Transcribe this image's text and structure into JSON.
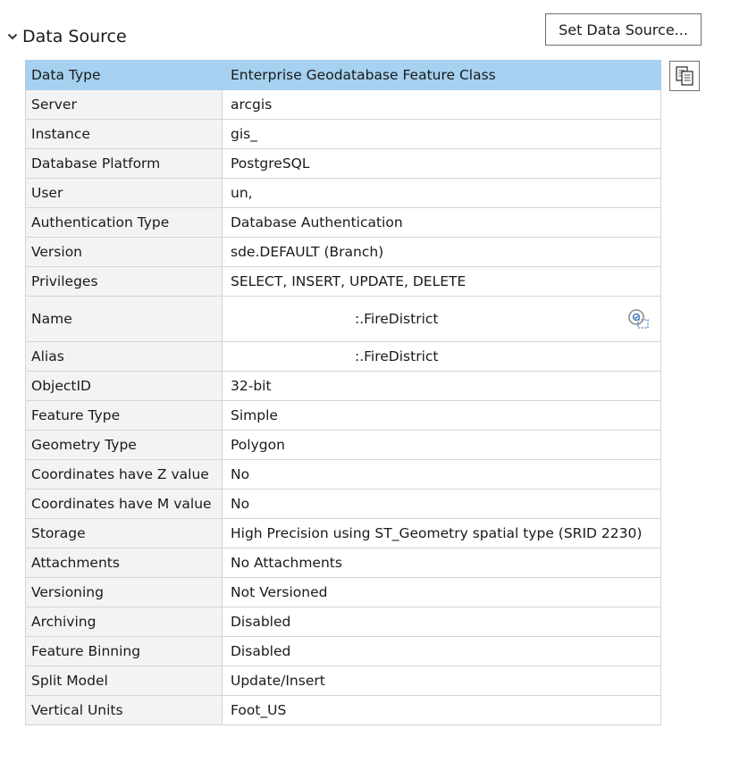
{
  "section": {
    "title": "Data Source",
    "collapse_icon": "chevron-down-icon"
  },
  "toolbar": {
    "set_data_source_label": "Set Data Source...",
    "copy_icon": "copy-icon"
  },
  "properties": [
    {
      "key": "Data Type",
      "value": "Enterprise Geodatabase Feature Class"
    },
    {
      "key": "Server",
      "value": "arcgis"
    },
    {
      "key": "Instance",
      "value": "gis_"
    },
    {
      "key": "Database Platform",
      "value": "PostgreSQL"
    },
    {
      "key": "User",
      "value": "un,"
    },
    {
      "key": "Authentication Type",
      "value": "Database Authentication"
    },
    {
      "key": "Version",
      "value": "sde.DEFAULT (Branch)"
    },
    {
      "key": "Privileges",
      "value": "SELECT, INSERT, UPDATE, DELETE"
    },
    {
      "key": "Name",
      "value": ":.FireDistrict"
    },
    {
      "key": "Alias",
      "value": ":.FireDistrict"
    },
    {
      "key": "ObjectID",
      "value": "32-bit"
    },
    {
      "key": "Feature Type",
      "value": "Simple"
    },
    {
      "key": "Geometry Type",
      "value": "Polygon"
    },
    {
      "key": "Coordinates have Z value",
      "value": "No"
    },
    {
      "key": "Coordinates have M value",
      "value": "No"
    },
    {
      "key": "Storage",
      "value": "High Precision using ST_Geometry spatial type (SRID 2230)"
    },
    {
      "key": "Attachments",
      "value": "No Attachments"
    },
    {
      "key": "Versioning",
      "value": "Not Versioned"
    },
    {
      "key": "Archiving",
      "value": "Disabled"
    },
    {
      "key": "Feature Binning",
      "value": "Disabled"
    },
    {
      "key": "Split Model",
      "value": "Update/Insert"
    },
    {
      "key": "Vertical Units",
      "value": "Foot_US"
    }
  ],
  "colors": {
    "header_row": "#a6d1f0",
    "key_cell": "#f3f3f3",
    "border": "#d4d4d4",
    "icon_blue": "#4a7fc1"
  }
}
